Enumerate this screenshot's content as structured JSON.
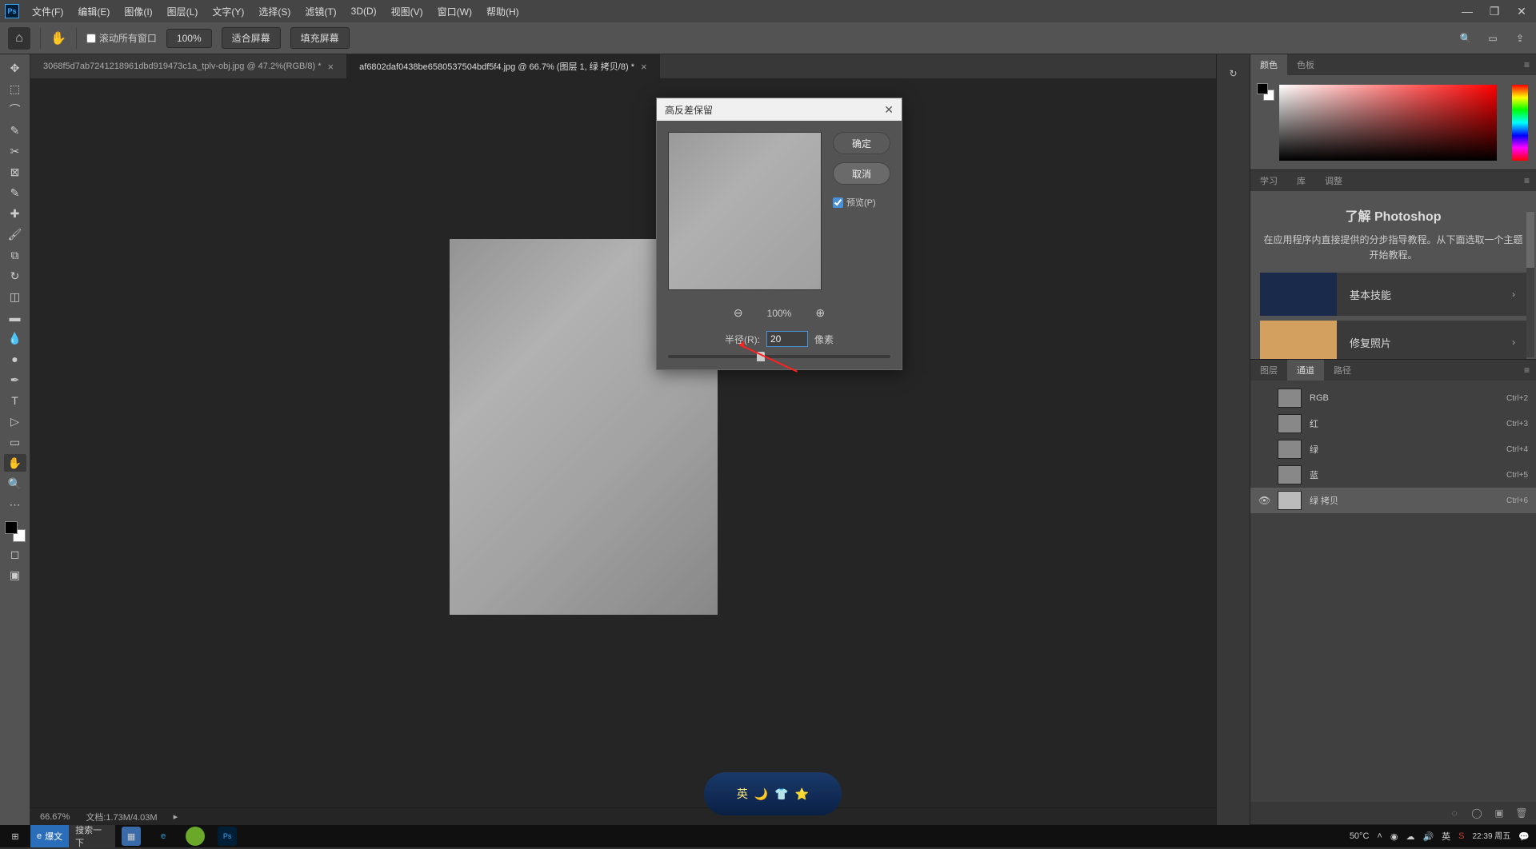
{
  "menubar": {
    "items": [
      "文件(F)",
      "编辑(E)",
      "图像(I)",
      "图层(L)",
      "文字(Y)",
      "选择(S)",
      "滤镜(T)",
      "3D(D)",
      "视图(V)",
      "窗口(W)",
      "帮助(H)"
    ]
  },
  "optbar": {
    "scroll_all": "滚动所有窗口",
    "zoom_value": "100%",
    "fit_screen": "适合屏幕",
    "fill_screen": "填充屏幕"
  },
  "tabs": [
    {
      "title": "3068f5d7ab7241218961dbd919473c1a_tplv-obj.jpg @ 47.2%(RGB/8) *",
      "active": false
    },
    {
      "title": "af6802daf0438be6580537504bdf5f4.jpg  @  66.7% (图层 1, 绿 拷贝/8) *",
      "active": true
    }
  ],
  "status": {
    "zoom": "66.67%",
    "docinfo": "文档:1.73M/4.03M"
  },
  "dialog": {
    "title": "高反差保留",
    "ok": "确定",
    "cancel": "取消",
    "preview": "预览(P)",
    "zoom": "100%",
    "radius_label": "半径(R):",
    "radius_value": "20",
    "unit": "像素"
  },
  "panels": {
    "color": {
      "tabs": [
        "颜色",
        "色板"
      ]
    },
    "learn": {
      "tabs": [
        "学习",
        "库",
        "调整"
      ],
      "title": "了解 Photoshop",
      "desc": "在应用程序内直接提供的分步指导教程。从下面选取一个主题开始教程。",
      "cards": [
        {
          "label": "基本技能"
        },
        {
          "label": "修复照片"
        }
      ]
    },
    "channels": {
      "tabs": [
        "图层",
        "通道",
        "路径"
      ],
      "rows": [
        {
          "name": "RGB",
          "key": "Ctrl+2",
          "eye": false
        },
        {
          "name": "红",
          "key": "Ctrl+3",
          "eye": false
        },
        {
          "name": "绿",
          "key": "Ctrl+4",
          "eye": false
        },
        {
          "name": "蓝",
          "key": "Ctrl+5",
          "eye": false
        },
        {
          "name": "绿 拷贝",
          "key": "Ctrl+6",
          "eye": true,
          "sel": true
        }
      ]
    }
  },
  "float": {
    "text": "英"
  },
  "taskbar": {
    "browser": "爆文",
    "search": "搜索一下",
    "temp": "50°C",
    "ime": "英",
    "time": "22:39 周五"
  }
}
